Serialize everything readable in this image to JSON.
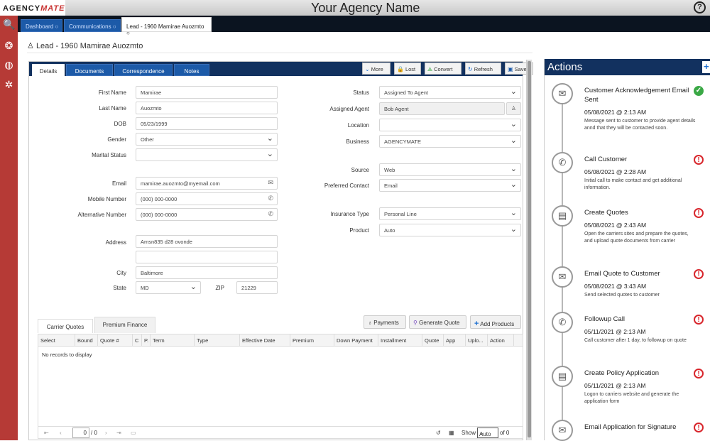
{
  "app": {
    "logo_part1": "AGENCY",
    "logo_part2": "MATE",
    "agency_name": "Your Agency Name",
    "help_icon": "?"
  },
  "leftnav": [
    {
      "name": "search-icon",
      "glyph": "🔍"
    },
    {
      "name": "award-icon",
      "glyph": "❂"
    },
    {
      "name": "dashboard-icon",
      "glyph": "◍"
    },
    {
      "name": "gear-icon",
      "glyph": "✲"
    }
  ],
  "top_tabs": [
    {
      "label": "Dashboard ○"
    },
    {
      "label": "Communications ○"
    },
    {
      "label": "Lead - 1960 Mamirae Auozmto ○",
      "active": true
    }
  ],
  "breadcrumb": "Lead - 1960 Mamirae Auozmto",
  "detail_tabs": [
    "Details",
    "Documents",
    "Correspondence",
    "Notes"
  ],
  "toolbar": {
    "more": "More",
    "lost": "Lost",
    "convert": "Convert",
    "refresh": "Refresh",
    "save": "Save"
  },
  "form_left": {
    "first_name": {
      "label": "First Name",
      "value": "Mamirae"
    },
    "last_name": {
      "label": "Last Name",
      "value": "Auozmto"
    },
    "dob": {
      "label": "DOB",
      "value": "05/23/1999"
    },
    "gender": {
      "label": "Gender",
      "value": "Other"
    },
    "marital_status": {
      "label": "Marital Status",
      "value": ""
    },
    "email": {
      "label": "Email",
      "value": "mamirae.auozmto@myemail.com"
    },
    "mobile": {
      "label": "Mobile Number",
      "value": "(000) 000-0000"
    },
    "alternative": {
      "label": "Alternative Number",
      "value": "(000) 000-0000"
    },
    "address": {
      "label": "Address",
      "value": "Amsn835 d28 ovonde",
      "value2": ""
    },
    "city": {
      "label": "City",
      "value": "Baltimore"
    },
    "state": {
      "label": "State",
      "value": "MD"
    },
    "zip": {
      "label": "ZIP",
      "value": "21229"
    }
  },
  "form_right": {
    "status": {
      "label": "Status",
      "value": "Assigned To Agent"
    },
    "assigned_agent": {
      "label": "Assigned Agent",
      "value": "Bob Agent"
    },
    "location": {
      "label": "Location",
      "value": ""
    },
    "business": {
      "label": "Business",
      "value": "AGENCYMATE"
    },
    "source": {
      "label": "Source",
      "value": "Web"
    },
    "preferred_contact": {
      "label": "Preferred Contact",
      "value": "Email"
    },
    "insurance_type": {
      "label": "Insurance Type",
      "value": "Personal Line"
    },
    "product": {
      "label": "Product",
      "value": "Auto"
    }
  },
  "bottom_tabs": [
    "Carrier Quotes",
    "Premium Finance"
  ],
  "grid_buttons": {
    "payments": "Payments",
    "generate_quote": "Generate Quote",
    "add_products": "Add Products"
  },
  "grid": {
    "columns": [
      "Select",
      "Bound",
      "Quote #",
      "C",
      "P.",
      "Term",
      "Type",
      "Effective Date",
      "Premium",
      "Down Payment",
      "Installment",
      "Quote",
      "App",
      "Uplo...",
      "Action"
    ],
    "empty_message": "No records to display",
    "pager": {
      "page_value": "0",
      "page_total": "/ 0",
      "show_label": "Show",
      "page_size": "Auto",
      "of_total": "of 0"
    }
  },
  "actions": {
    "title": "Actions",
    "add_icon": "+",
    "items": [
      {
        "title": "Customer Acknowledgement Email Sent",
        "date": "05/08/2021 @ 2:13 AM",
        "desc": "Message sent to customer to provide agent details annd that they will be contacted soon.",
        "icon": "envelope",
        "glyph": "✉",
        "status": "complete",
        "status_glyph": "✓"
      },
      {
        "title": "Call Customer",
        "date": "05/08/2021 @ 2:28 AM",
        "desc": "Initial call to make contact and get additional information.",
        "icon": "phone",
        "glyph": "✆",
        "status": "pending",
        "status_glyph": "!"
      },
      {
        "title": "Create Quotes",
        "date": "05/08/2021 @ 2:43 AM",
        "desc": "Open the carriers sites and prepare the quotes, and upload quote documents from carrier",
        "icon": "document",
        "glyph": "▤",
        "status": "pending",
        "status_glyph": "!"
      },
      {
        "title": "Email Quote to Customer",
        "date": "05/08/2021 @ 3:43 AM",
        "desc": "Send selected quotes to customer",
        "icon": "envelope",
        "glyph": "✉",
        "status": "pending",
        "status_glyph": "!"
      },
      {
        "title": "Followup Call",
        "date": "05/11/2021 @ 2:13 AM",
        "desc": "Call customer after 1 day, to followup on quote",
        "icon": "phone",
        "glyph": "✆",
        "status": "pending",
        "status_glyph": "!"
      },
      {
        "title": "Create Policy Application",
        "date": "05/11/2021 @ 2:13 AM",
        "desc": "Logon to carriers website and generate the application form",
        "icon": "document",
        "glyph": "▤",
        "status": "pending",
        "status_glyph": "!"
      },
      {
        "title": "Email Application for Signature",
        "date": "",
        "desc": "",
        "icon": "envelope",
        "glyph": "✉",
        "status": "pending",
        "status_glyph": "!"
      }
    ]
  },
  "colors": {
    "brand_red": "#b63a36",
    "navy": "#12315f",
    "tab_blue": "#1c5aa8",
    "success": "#3aa845",
    "warning": "#d8262c"
  }
}
